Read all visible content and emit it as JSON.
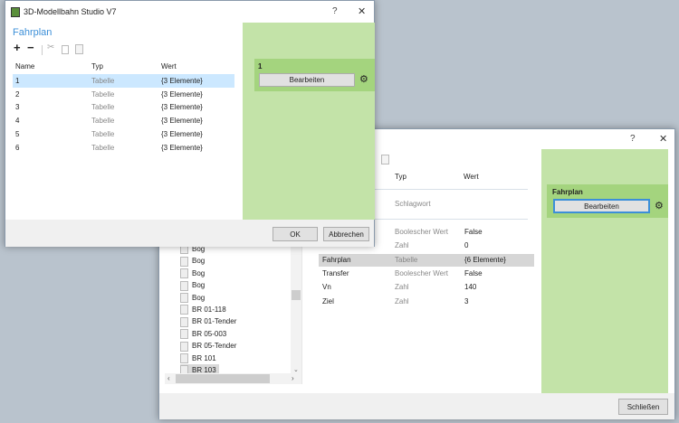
{
  "back_window": {
    "help": "?",
    "close": "✕",
    "columns": [
      "Typ",
      "Wert"
    ],
    "schlagwort_row": {
      "typ": "Schlagwort"
    },
    "properties": [
      {
        "name": "",
        "typ": "Boolescher Wert",
        "wert": "False"
      },
      {
        "name": "",
        "typ": "Zahl",
        "wert": "0"
      },
      {
        "name": "Fahrplan",
        "typ": "Tabelle",
        "wert": "{6 Elemente}"
      },
      {
        "name": "Transfer",
        "typ": "Boolescher Wert",
        "wert": "False"
      },
      {
        "name": "Vn",
        "typ": "Zahl",
        "wert": "140"
      },
      {
        "name": "Ziel",
        "typ": "Zahl",
        "wert": "3"
      }
    ],
    "tree": [
      "Bog",
      "Bog",
      "Bog",
      "Bog",
      "Bog",
      "BR 01-118",
      "BR 01-Tender",
      "BR 05-003",
      "BR 05-Tender",
      "BR 101",
      "BR 103"
    ],
    "panel": {
      "title": "Fahrplan",
      "edit_button": "Bearbeiten"
    },
    "close_button": "Schließen"
  },
  "front_window": {
    "title": "3D-Modellbahn Studio V7",
    "help": "?",
    "close": "✕",
    "heading": "Fahrplan",
    "columns": [
      "Name",
      "Typ",
      "Wert"
    ],
    "rows": [
      {
        "name": "1",
        "typ": "Tabelle",
        "wert": "{3 Elemente}"
      },
      {
        "name": "2",
        "typ": "Tabelle",
        "wert": "{3 Elemente}"
      },
      {
        "name": "3",
        "typ": "Tabelle",
        "wert": "{3 Elemente}"
      },
      {
        "name": "4",
        "typ": "Tabelle",
        "wert": "{3 Elemente}"
      },
      {
        "name": "5",
        "typ": "Tabelle",
        "wert": "{3 Elemente}"
      },
      {
        "name": "6",
        "typ": "Tabelle",
        "wert": "{3 Elemente}"
      }
    ],
    "panel": {
      "title": "1",
      "edit_button": "Bearbeiten"
    },
    "ok": "OK",
    "cancel": "Abbrechen",
    "accent": "#3c8fd8"
  }
}
